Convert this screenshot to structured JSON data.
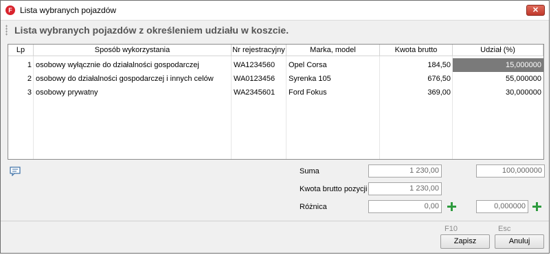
{
  "window": {
    "title": "Lista wybranych pojazdów",
    "app_icon_letter": "F",
    "close_symbol": "✕"
  },
  "header": {
    "text": "Lista wybranych pojazdów z określeniem udziału w koszcie."
  },
  "table": {
    "columns": [
      "Lp",
      "Sposób wykorzystania",
      "Nr rejestracyjny",
      "Marka, model",
      "Kwota brutto",
      "Udział (%)"
    ],
    "rows": [
      {
        "lp": "1",
        "sposob": "osobowy wyłącznie do działalności gospodarczej",
        "nr": "WA1234560",
        "marka": "Opel Corsa",
        "kwota": "184,50",
        "udzial": "15,000000"
      },
      {
        "lp": "2",
        "sposob": "osobowy do działalności gospodarczej i innych celów",
        "nr": "WA0123456",
        "marka": "Syrenka 105",
        "kwota": "676,50",
        "udzial": "55,000000"
      },
      {
        "lp": "3",
        "sposob": "osobowy prywatny",
        "nr": "WA2345601",
        "marka": "Ford Fokus",
        "kwota": "369,00",
        "udzial": "30,000000"
      }
    ],
    "selected_color": "#7a7a7a"
  },
  "summary": {
    "suma_label": "Suma",
    "suma_kwota": "1 230,00",
    "suma_udzial": "100,000000",
    "kwota_pozycji_label": "Kwota brutto pozycji",
    "kwota_pozycji": "1 230,00",
    "roznica_label": "Różnica",
    "roznica_kwota": "0,00",
    "roznica_udzial": "0,000000"
  },
  "icons": {
    "comment": "comment-icon",
    "plus": "plus-icon",
    "plus_color": "#2e9b3e"
  },
  "buttons": {
    "save_hint": "F10",
    "save_label": "Zapisz",
    "cancel_hint": "Esc",
    "cancel_label": "Anuluj"
  }
}
